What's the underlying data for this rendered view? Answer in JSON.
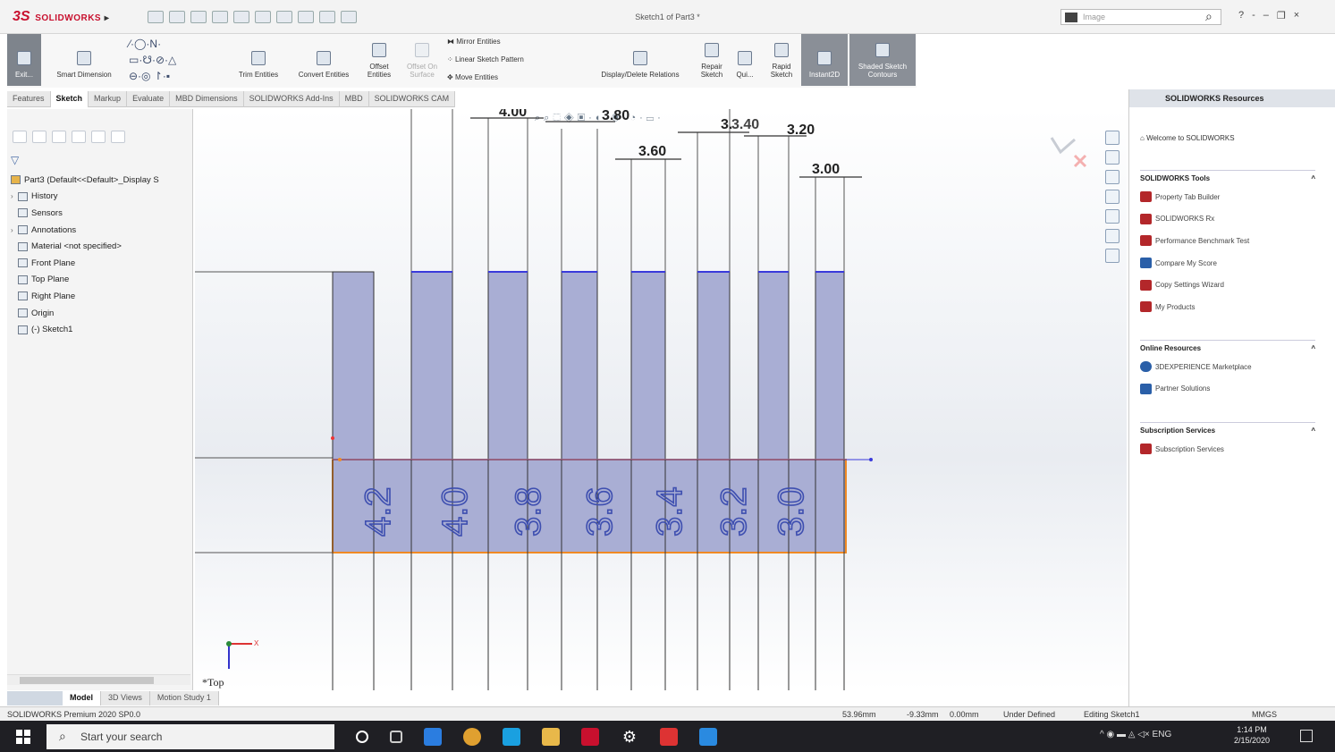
{
  "app": {
    "title": "Sketch1 of Part3 *",
    "logo_ds": "3S",
    "logo_text": "SOLIDWORKS",
    "search_placeholder": "Image",
    "window_controls": [
      "?",
      "-",
      "–",
      "❐",
      "×"
    ]
  },
  "ribbon": {
    "exit_label": "Exit...",
    "smart_dimension": "Smart Dimension",
    "trim_entities": "Trim Entities",
    "convert_entities": "Convert Entities",
    "offset_entities": "Offset Entities",
    "offset_surface": "Offset On Surface",
    "mirror_entities": "Mirror Entities",
    "linear_pattern": "Linear Sketch Pattern",
    "move_entities": "Move Entities",
    "display_delete_relations": "Display/Delete Relations",
    "repair_sketch": "Repair Sketch",
    "quick_snaps": "Qui...",
    "rapid_sketch": "Rapid Sketch",
    "instant2d": "Instant2D",
    "shaded_contours": "Shaded Sketch Contours"
  },
  "tabs": [
    "Features",
    "Sketch",
    "Markup",
    "Evaluate",
    "MBD Dimensions",
    "SOLIDWORKS Add-Ins",
    "MBD",
    "SOLIDWORKS CAM"
  ],
  "active_tab": "Sketch",
  "tree": {
    "root": "Part3 (Default<<Default>_Display S",
    "items": [
      {
        "label": "History",
        "expand": "›"
      },
      {
        "label": "Sensors",
        "expand": ""
      },
      {
        "label": "Annotations",
        "expand": "›"
      },
      {
        "label": "Material <not specified>",
        "expand": ""
      },
      {
        "label": "Front Plane",
        "expand": ""
      },
      {
        "label": "Top Plane",
        "expand": ""
      },
      {
        "label": "Right Plane",
        "expand": ""
      },
      {
        "label": "Origin",
        "expand": ""
      },
      {
        "label": "(-) Sketch1",
        "expand": ""
      }
    ]
  },
  "viewport": {
    "view_label": "*Top",
    "dimensions": [
      "4.00",
      "3.80",
      "3.60",
      "3.40",
      "3.20",
      "3.00"
    ],
    "dimension_partial": "3.",
    "engraved_labels": [
      "4.2",
      "4.0",
      "3.8",
      "3.6",
      "3.4",
      "3.2",
      "3.0"
    ],
    "axis_x": "X"
  },
  "resources": {
    "header": "SOLIDWORKS Resources",
    "welcome": "Welcome to SOLIDWORKS",
    "sections": [
      {
        "title": "SOLIDWORKS Tools",
        "items": [
          "Property Tab Builder",
          "SOLIDWORKS Rx",
          "Performance Benchmark Test",
          "Compare My Score",
          "Copy Settings Wizard",
          "My Products"
        ]
      },
      {
        "title": "Online Resources",
        "items": [
          "3DEXPERIENCE Marketplace",
          "Partner Solutions"
        ]
      },
      {
        "title": "Subscription Services",
        "items": [
          "Subscription Services"
        ]
      }
    ]
  },
  "bottom_tabs": [
    "Model",
    "3D Views",
    "Motion Study 1"
  ],
  "status": {
    "product": "SOLIDWORKS Premium 2020 SP0.0",
    "x": "53.96mm",
    "y": "-9.33mm",
    "z": "0.00mm",
    "state": "Under Defined",
    "editing": "Editing Sketch1",
    "units": "MMGS"
  },
  "taskbar": {
    "search": "Start your search",
    "lang": "ENG",
    "time": "1:14 PM",
    "date": "2/15/2020"
  },
  "colors": {
    "slot_fill": "#a9aed4",
    "sketch_blue": "#3a3adb",
    "engrave_blue": "#3e4fb0",
    "plate_outline": "#f08a24",
    "brand_red": "#c8102e"
  }
}
